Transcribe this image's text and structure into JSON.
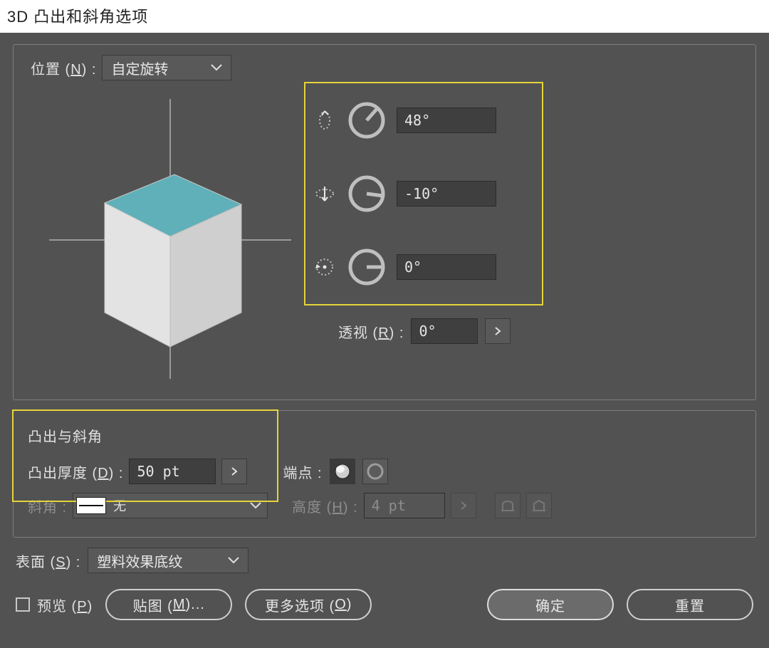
{
  "title": "3D 凸出和斜角选项",
  "position": {
    "label_pre": "位置 (",
    "label_key": "N",
    "label_post": ") :",
    "value": "自定旋转"
  },
  "rotation": {
    "x": "48°",
    "y": "-10°",
    "z": "0°"
  },
  "perspective": {
    "label_pre": "透视 (",
    "label_key": "R",
    "label_post": ") :",
    "value": "0°"
  },
  "extrude": {
    "section_title": "凸出与斜角",
    "depth_label_pre": "凸出厚度 (",
    "depth_label_key": "D",
    "depth_label_post": ") :",
    "depth_value": "50 pt",
    "cap_label": "端点 :",
    "bevel_label": "斜角 :",
    "bevel_value": "无",
    "height_label_pre": "高度 (",
    "height_label_key": "H",
    "height_label_post": ") :",
    "height_value": "4 pt"
  },
  "surface": {
    "label_pre": "表面 (",
    "label_key": "S",
    "label_post": ") :",
    "value": "塑料效果底纹"
  },
  "footer": {
    "preview_pre": "预览 (",
    "preview_key": "P",
    "preview_post": ")",
    "map_pre": "贴图 (",
    "map_key": "M",
    "map_post": ")...",
    "more_pre": "更多选项 (",
    "more_key": "O",
    "more_post": ")",
    "ok": "确定",
    "reset": "重置"
  }
}
